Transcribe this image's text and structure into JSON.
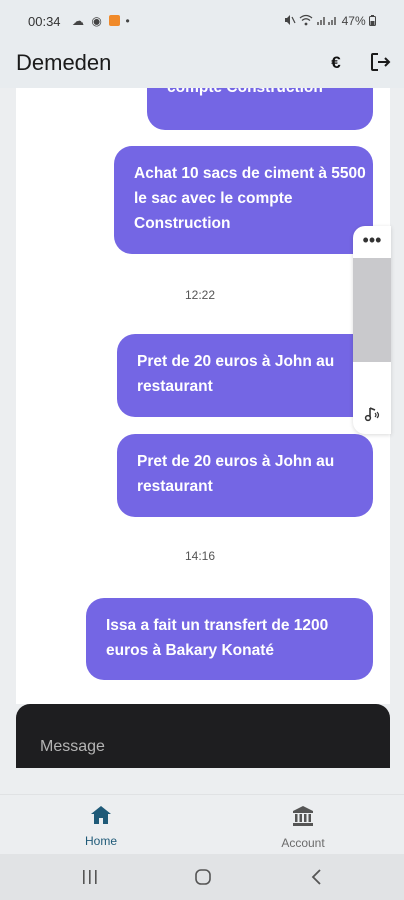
{
  "status_bar": {
    "time": "00:34",
    "left_icons": [
      "cloud-icon",
      "chrome-icon",
      "notification-icon",
      "dot-icon"
    ],
    "battery": "47%",
    "right_icons": [
      "mute-icon",
      "wifi-icon",
      "signal-icon",
      "battery-icon"
    ]
  },
  "app_bar": {
    "title": "Demeden",
    "currency_symbol": "€",
    "logout_icon": "logout-icon"
  },
  "messages": [
    {
      "type": "bubble",
      "text": "compte Construction"
    },
    {
      "type": "bubble",
      "text": "Achat 10 sacs de ciment à 5500 le sac avec le compte Construction"
    },
    {
      "type": "timestamp",
      "text": "12:22"
    },
    {
      "type": "bubble",
      "text": "Pret de 20 euros à John au restaurant"
    },
    {
      "type": "bubble",
      "text": "Pret de 20 euros à John au restaurant"
    },
    {
      "type": "timestamp",
      "text": "14:16"
    },
    {
      "type": "bubble",
      "text": "Issa a fait un transfert de 1200 euros à Bakary Konaté"
    }
  ],
  "composer": {
    "placeholder": "Message"
  },
  "bottom_nav": {
    "items": [
      {
        "label": "Home",
        "icon": "home-icon",
        "active": true
      },
      {
        "label": "Account",
        "icon": "bank-icon",
        "active": false
      }
    ]
  },
  "colors": {
    "bubble": "#7466e4",
    "active_nav": "#1f5a78",
    "inactive_nav": "#6b6b6b",
    "composer": "#1e1e20"
  }
}
